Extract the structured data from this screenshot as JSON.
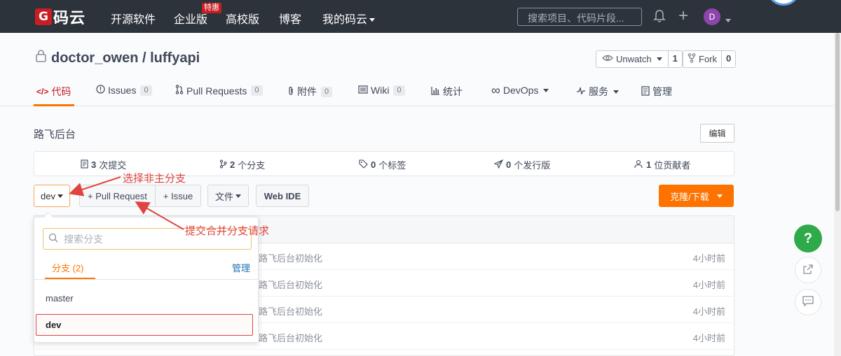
{
  "nav": {
    "logo_mark": "G",
    "logo_text": "码云",
    "items": [
      "开源软件",
      "企业版",
      "高校版",
      "博客",
      "我的码云"
    ],
    "enterprise_badge": "特惠",
    "search_placeholder": "搜索项目、代码片段...",
    "avatar_initial": "D"
  },
  "repo": {
    "title": "doctor_owen / luffyapi",
    "watch_label": "Unwatch",
    "watch_count": "1",
    "fork_label": "Fork",
    "fork_count": "0"
  },
  "tabs": [
    {
      "label": "代码"
    },
    {
      "label": "Issues",
      "count": "0"
    },
    {
      "label": "Pull Requests",
      "count": "0"
    },
    {
      "label": "附件",
      "count": "0"
    },
    {
      "label": "Wiki",
      "count": "0"
    },
    {
      "label": "统计"
    },
    {
      "label": "DevOps"
    },
    {
      "label": "服务"
    },
    {
      "label": "管理"
    }
  ],
  "description": "路飞后台",
  "edit_label": "编辑",
  "stats": {
    "commits_num": "3",
    "commits_label": "次提交",
    "branches_num": "2",
    "branches_label": "个分支",
    "tags_num": "0",
    "tags_label": "个标签",
    "releases_num": "0",
    "releases_label": "个发行版",
    "contributors_num": "1",
    "contributors_label": "位贡献者"
  },
  "toolbar": {
    "branch": "dev",
    "pull_request": "+ Pull Request",
    "issue": "+ Issue",
    "file": "文件",
    "web_ide": "Web IDE",
    "clone": "克隆/下载"
  },
  "commits": [
    {
      "msg": "路飞后台初始化",
      "time": "4小时前"
    },
    {
      "msg": "路飞后台初始化",
      "time": "4小时前"
    },
    {
      "msg": "路飞后台初始化",
      "time": "4小时前"
    },
    {
      "msg": "路飞后台初始化",
      "time": "4小时前"
    }
  ],
  "dropdown": {
    "search_placeholder": "搜索分支",
    "tab_label": "分支 (2)",
    "manage_label": "管理",
    "branches": [
      "master",
      "dev"
    ]
  },
  "annotations": {
    "select_branch": "选择非主分支",
    "submit_pr": "提交合并分支请求"
  },
  "float": {
    "help": "?"
  },
  "colors": {
    "nav_bg": "#2d333b",
    "brand_red": "#c71d23",
    "accent_orange": "#fe7300",
    "annotation_red": "#e0443e",
    "help_green": "#2eaa4a"
  }
}
